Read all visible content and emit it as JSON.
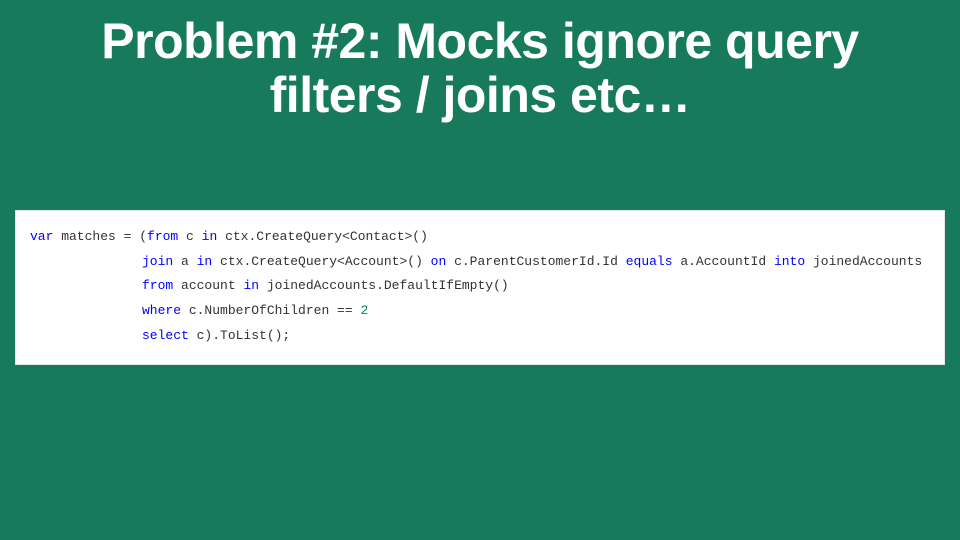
{
  "title": "Problem #2: Mocks ignore query filters / joins etc…",
  "code": {
    "l1": {
      "kw_var": "var",
      "a": " matches = (",
      "kw_from": "from",
      "b": " c ",
      "kw_in": "in",
      "c": " ctx.CreateQuery<Contact>()"
    },
    "l2": {
      "kw_join": "join",
      "a": " a ",
      "kw_in": "in",
      "b": " ctx.CreateQuery<Account>() ",
      "kw_on": "on",
      "c": " c.ParentCustomerId.Id ",
      "kw_equals": "equals",
      "d": " a.AccountId ",
      "kw_into": "into",
      "e": " joinedAccounts"
    },
    "l3": {
      "kw_from": "from",
      "a": " account ",
      "kw_in": "in",
      "b": " joinedAccounts.DefaultIfEmpty()"
    },
    "l4": {
      "kw_where": "where",
      "a": " c.NumberOfChildren == ",
      "num": "2"
    },
    "l5": {
      "kw_select": "select",
      "a": " c).ToList();"
    }
  }
}
